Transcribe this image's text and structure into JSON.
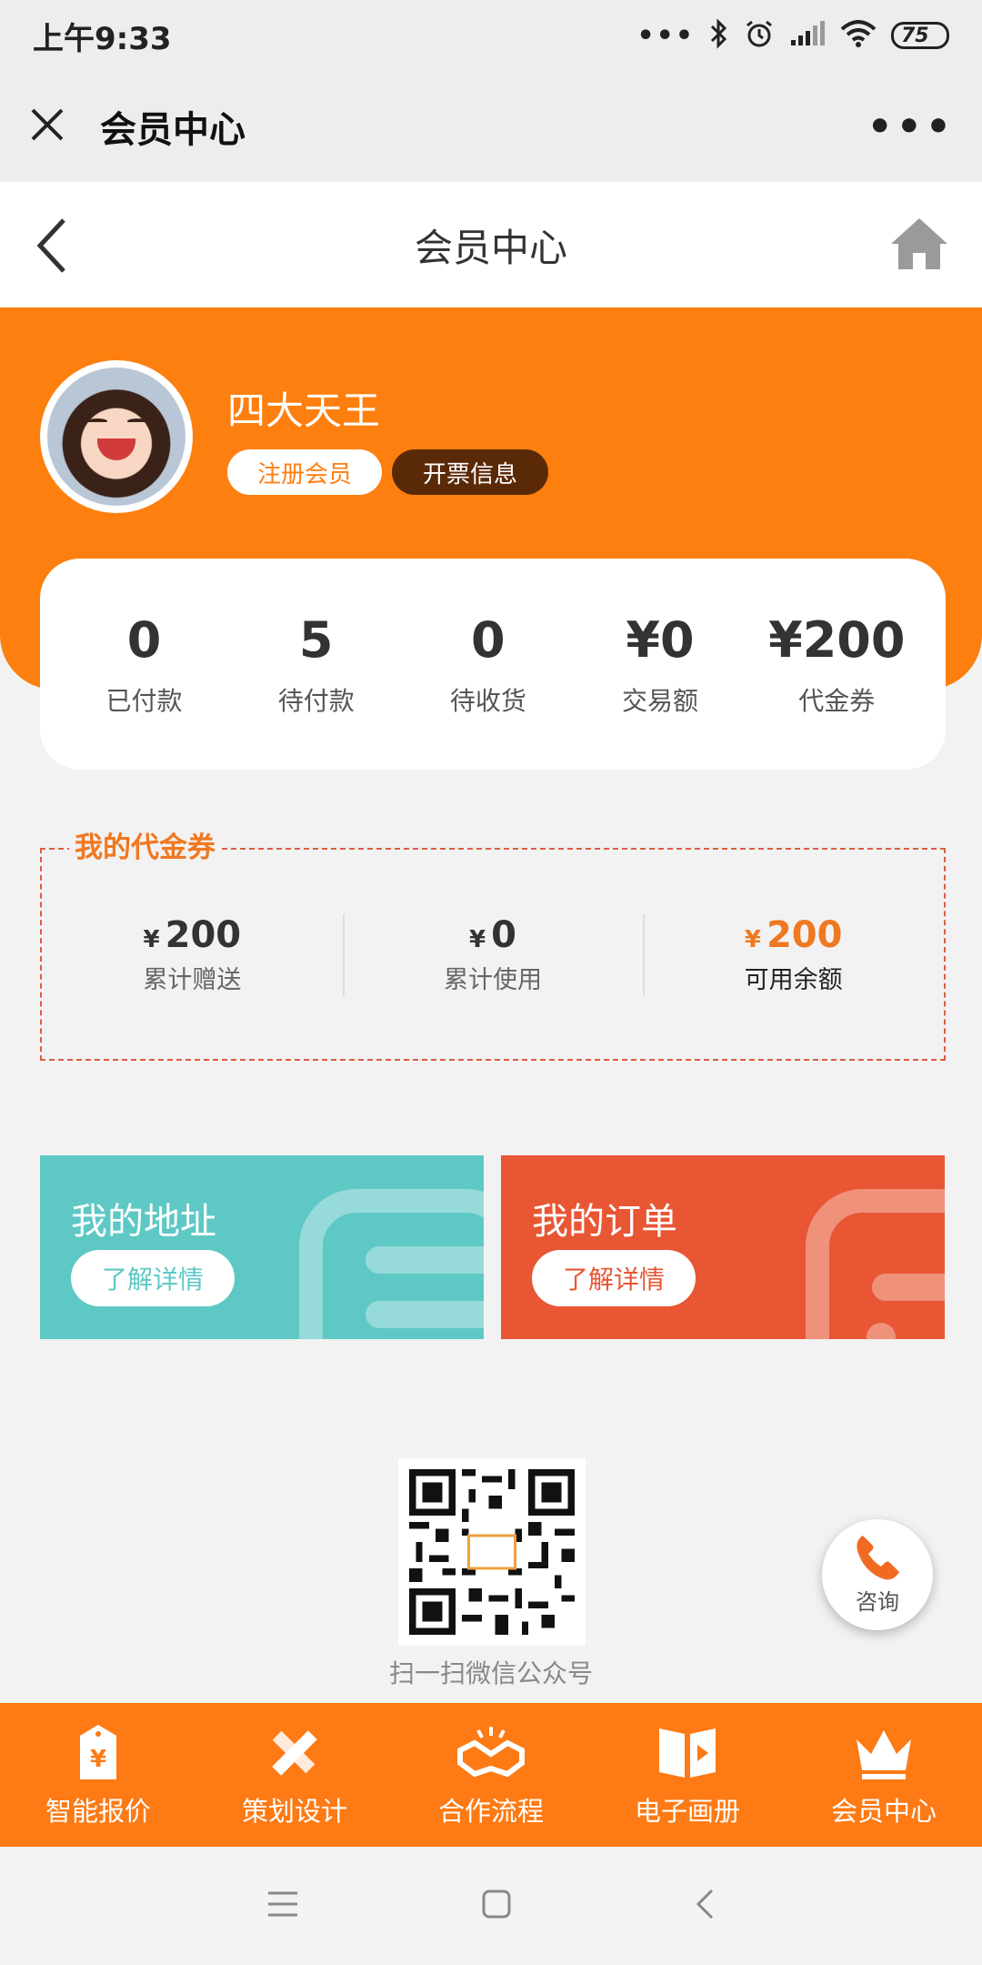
{
  "status_bar": {
    "time": "上午9:33",
    "battery": "75"
  },
  "wechat_header": {
    "title": "会员中心"
  },
  "nav": {
    "title": "会员中心"
  },
  "profile": {
    "name": "四大天王",
    "tag_member": "注册会员",
    "tag_invoice": "开票信息"
  },
  "stats": [
    {
      "value": "0",
      "label": "已付款"
    },
    {
      "value": "5",
      "label": "待付款"
    },
    {
      "value": "0",
      "label": "待收货"
    },
    {
      "value": "¥0",
      "label": "交易额"
    },
    {
      "value": "¥200",
      "label": "代金券"
    }
  ],
  "voucher": {
    "title": "我的代金券",
    "items": [
      {
        "yen": "¥",
        "amount": "200",
        "label": "累计赠送"
      },
      {
        "yen": "¥",
        "amount": "0",
        "label": "累计使用"
      },
      {
        "yen": "¥",
        "amount": "200",
        "label": "可用余额"
      }
    ]
  },
  "cards": {
    "address": {
      "title": "我的地址",
      "button": "了解详情"
    },
    "orders": {
      "title": "我的订单",
      "button": "了解详情"
    }
  },
  "qr": {
    "label": "扫一扫微信公众号"
  },
  "consult": {
    "label": "咨询"
  },
  "tabbar": [
    {
      "label": "智能报价",
      "icon": "price-tag-icon"
    },
    {
      "label": "策划设计",
      "icon": "ruler-pencil-icon"
    },
    {
      "label": "合作流程",
      "icon": "handshake-icon"
    },
    {
      "label": "电子画册",
      "icon": "book-play-icon"
    },
    {
      "label": "会员中心",
      "icon": "crown-icon"
    }
  ],
  "colors": {
    "accent": "#fd7f10",
    "teal": "#5ec8c5",
    "red": "#e85634",
    "dark_tag": "#5a2a08"
  }
}
